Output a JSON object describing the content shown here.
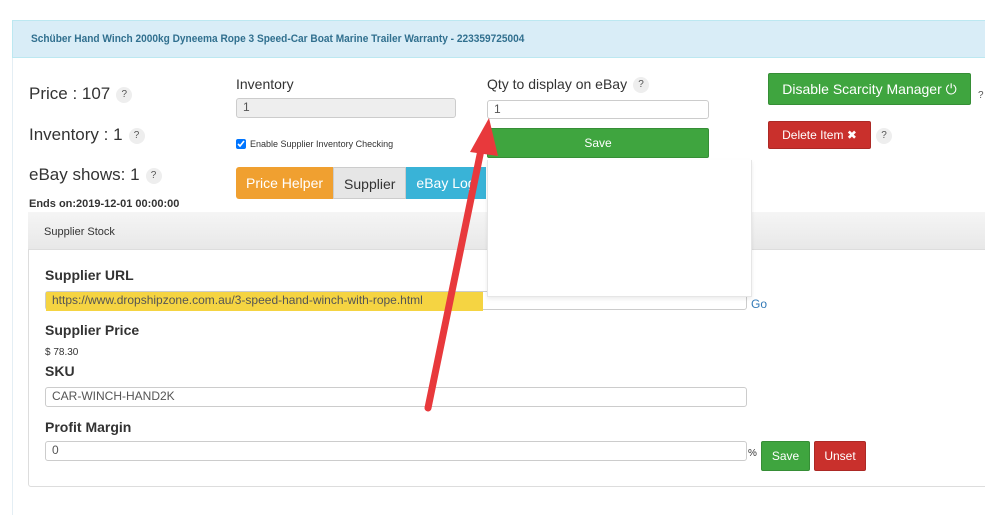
{
  "header": {
    "title": "Schüber Hand Winch 2000kg Dyneema Rope 3 Speed-Car Boat Marine Trailer Warranty - 223359725004"
  },
  "summary": {
    "price": "Price : 107",
    "inventory": "Inventory : 1",
    "ebay_shows": "eBay shows: 1",
    "ends_on": "Ends on:2019-12-01 00:00:00",
    "help": "?"
  },
  "inventory": {
    "label": "Inventory",
    "value": "1",
    "checkbox_label": "Enable Supplier Inventory Checking",
    "checked": true
  },
  "qty": {
    "label": "Qty to display on eBay",
    "value": "1",
    "save": "Save"
  },
  "actions": {
    "disable_scarcity": "Disable Scarcity Manager",
    "delete_item": "Delete Item"
  },
  "tabs": [
    {
      "label": "Price Helper",
      "color": "#f0a030"
    },
    {
      "label": "Supplier",
      "color": "#e6e6e6"
    },
    {
      "label": "eBay Log",
      "color": "#39b3d7"
    }
  ],
  "supplier": {
    "panel_title": "Supplier Stock",
    "url_label": "Supplier URL",
    "url": "https://www.dropshipzone.com.au/3-speed-hand-winch-with-rope.html",
    "go": "Go",
    "price_label": "Supplier Price",
    "price": "$ 78.30",
    "sku_label": "SKU",
    "sku": "CAR-WINCH-HAND2K",
    "margin_label": "Profit Margin",
    "margin": "0",
    "percent": "%",
    "save": "Save",
    "unset": "Unset"
  },
  "annotation": {
    "arrow_color": "#e8393c"
  }
}
